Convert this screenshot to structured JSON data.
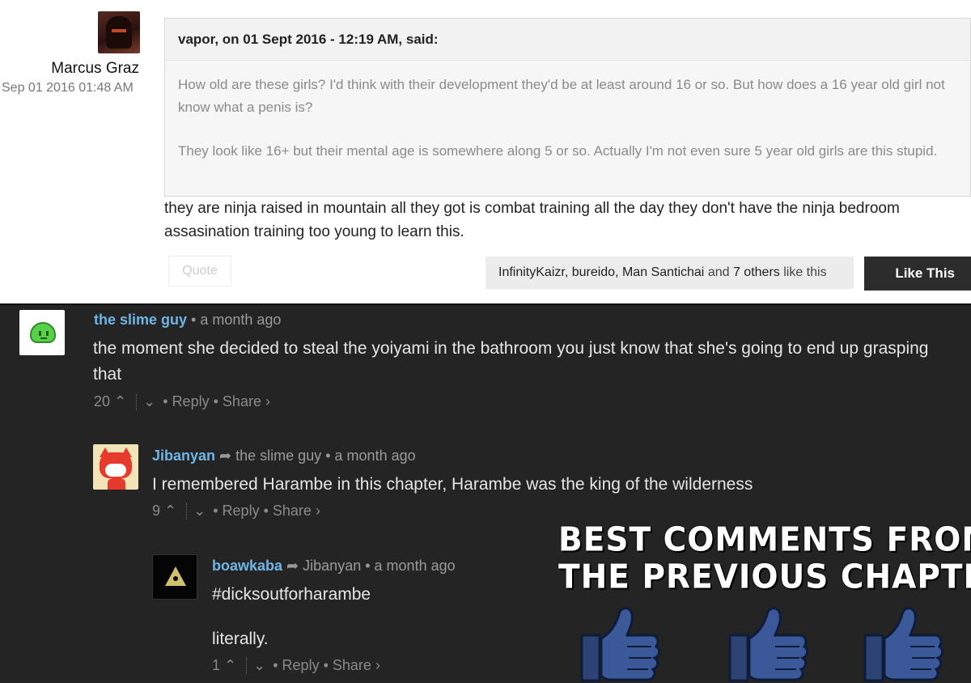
{
  "forum_post": {
    "author": "Marcus Graz",
    "date": "Sep 01 2016 01:48 AM",
    "quote": {
      "header": "vapor, on 01 Sept 2016 - 12:19 AM, said:",
      "paragraphs": [
        "How old are these girls? I'd think with their development they'd be at least around 16 or so. But how does a 16 year old girl not know what a penis is?",
        "They look like 16+ but their mental age is somewhere along 5 or so. Actually I'm not even sure 5 year old girls are this stupid."
      ]
    },
    "body": "they are ninja raised in mountain all they got is combat training all the day they don't have the ninja bedroom assasination training too young to learn this.",
    "quote_button": "Quote",
    "likes": {
      "names": "InfinityKaizr, bureido, Man Santichai",
      "and_others": "and 7 others",
      "suffix": "like this"
    },
    "like_button": "Like This"
  },
  "thread": {
    "comments": [
      {
        "author": "the slime guy",
        "time": "• a month ago",
        "text": "the moment she decided to steal the yoiyami in the bathroom you just know that she's going to end up grasping that",
        "votes": "20",
        "reply": "Reply",
        "share": "Share ›"
      },
      {
        "author": "Jibanyan",
        "reply_to": "the slime guy",
        "time": "• a month ago",
        "text": "I remembered Harambe in this chapter, Harambe was the king of the wilderness",
        "votes": "9",
        "reply": "Reply",
        "share": "Share ›"
      },
      {
        "author": "boawkaba",
        "reply_to": "Jibanyan",
        "time": "• a month ago",
        "text1": "#dicksoutforharambe",
        "text2": "literally.",
        "votes": "1",
        "reply": "Reply",
        "share": "Share ›"
      }
    ]
  },
  "banner": {
    "line1": "BEST COMMENTS FROM",
    "line2": "THE PREVIOUS CHAPTER",
    "thumb_color": "#3b5998"
  }
}
